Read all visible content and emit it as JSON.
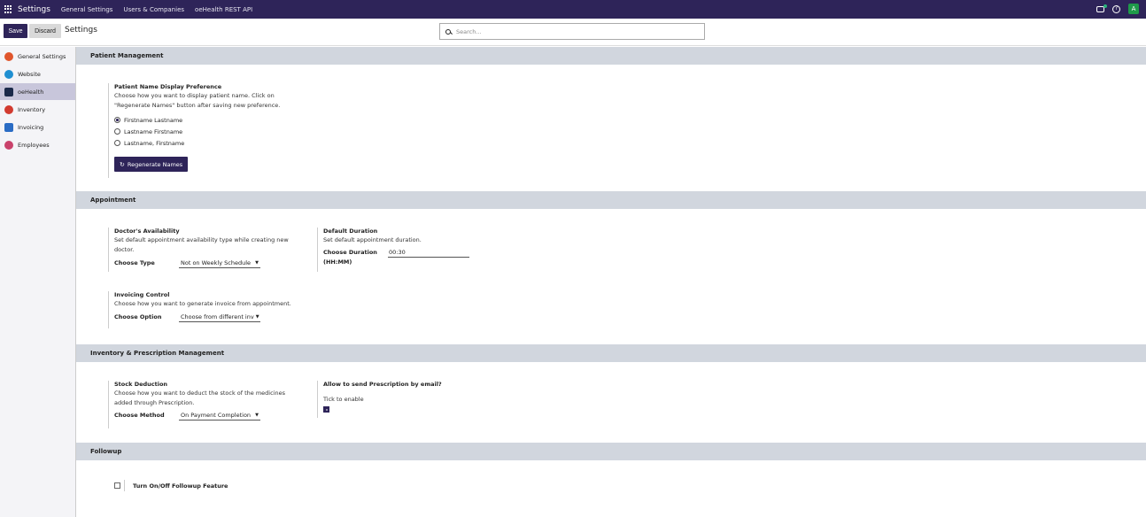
{
  "navbar": {
    "app_title": "Settings",
    "menu": [
      "General Settings",
      "Users & Companies",
      "oeHealth REST API"
    ],
    "avatar_letter": "A"
  },
  "control_panel": {
    "save_label": "Save",
    "discard_label": "Discard",
    "title": "Settings",
    "search_placeholder": "Search..."
  },
  "sidebar": {
    "items": [
      {
        "label": "General Settings",
        "icon": "odoo-icon",
        "color": "#e0552c"
      },
      {
        "label": "Website",
        "icon": "globe-icon",
        "color": "#1f8fd1"
      },
      {
        "label": "oeHealth",
        "icon": "health-icon",
        "color": "#1b2a4a"
      },
      {
        "label": "Inventory",
        "icon": "box-icon",
        "color": "#d23b30"
      },
      {
        "label": "Invoicing",
        "icon": "invoice-icon",
        "color": "#2a6cc4"
      },
      {
        "label": "Employees",
        "icon": "people-icon",
        "color": "#c9426b"
      }
    ],
    "active_index": 2
  },
  "sections": {
    "patient": {
      "header": "Patient Management",
      "title": "Patient Name Display Preference",
      "description": "Choose how you want to display patient name. Click on \"Regenerate Names\" button after saving new preference.",
      "options": [
        "Firstname Lastname",
        "Lastname Firstname",
        "Lastname, Firstname"
      ],
      "selected_option": "Firstname Lastname",
      "regenerate_label": "Regenerate Names"
    },
    "appointment": {
      "header": "Appointment",
      "availability_title": "Doctor's Availability",
      "availability_desc": "Set default appointment availability type while creating new doctor.",
      "choose_type_label": "Choose Type",
      "choose_type_value": "Not on Weekly Schedule",
      "duration_title": "Default Duration",
      "duration_desc": "Set default appointment duration.",
      "duration_label": "Choose Duration (HH:MM)",
      "duration_value": "00:30",
      "invoicing_title": "Invoicing Control",
      "invoicing_desc": "Choose how you want to generate invoice from appointment.",
      "choose_option_label": "Choose Option",
      "choose_option_value": "Choose from different inv"
    },
    "inventory": {
      "header": "Inventory & Prescription Management",
      "stock_title": "Stock Deduction",
      "stock_desc": "Choose how you want to deduct the stock of the medicines added through Prescription.",
      "choose_method_label": "Choose Method",
      "choose_method_value": "On Payment Completion",
      "email_title": "Allow to send Prescription by email?",
      "tick_label": "Tick to enable",
      "email_enabled": true
    },
    "followup": {
      "header": "Followup",
      "toggle_label": "Turn On/Off Followup Feature",
      "enabled": false
    }
  }
}
